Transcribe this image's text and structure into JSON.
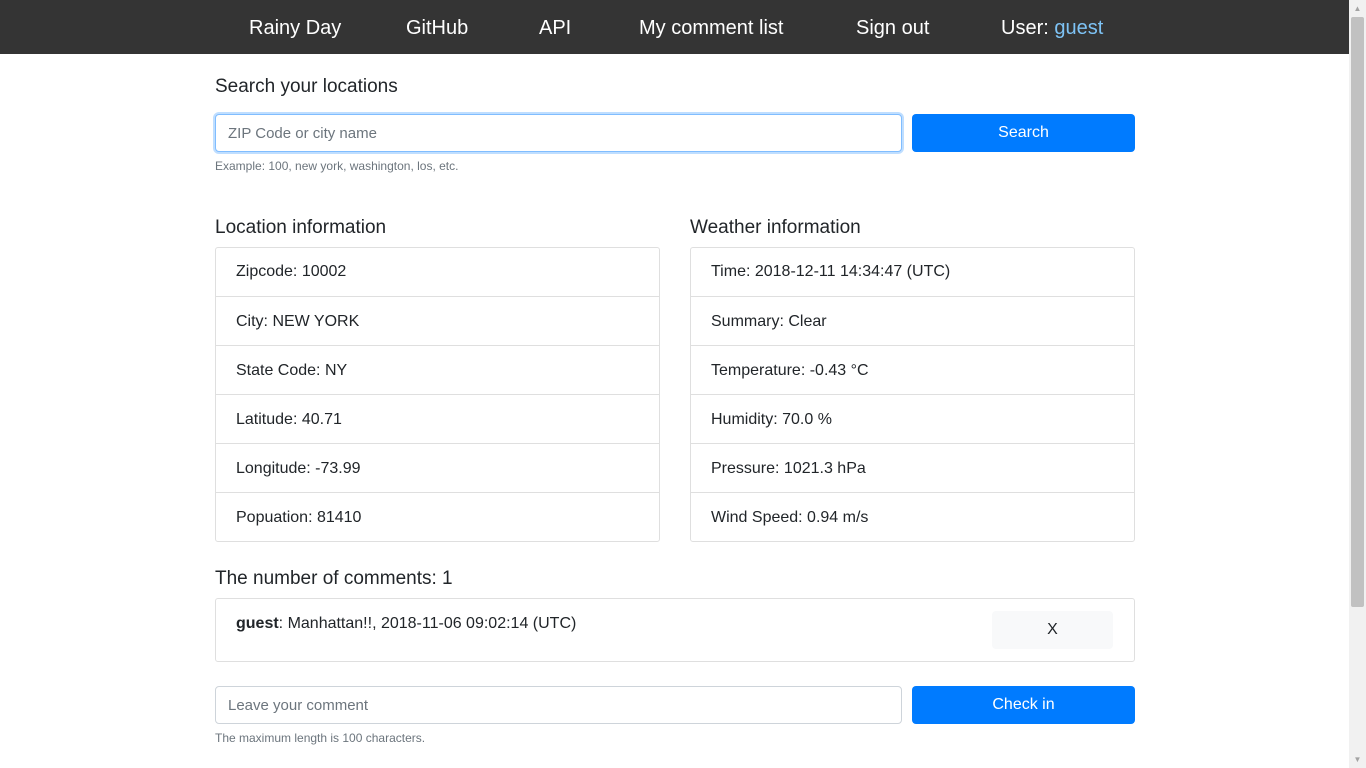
{
  "nav": {
    "brand": "Rainy Day",
    "github": "GitHub",
    "api": "API",
    "comment_list": "My comment list",
    "sign_out": "Sign out",
    "user_label": "User: ",
    "user_name": "guest"
  },
  "search": {
    "heading": "Search your locations",
    "placeholder": "ZIP Code or city name",
    "button": "Search",
    "help": "Example: 100, new york, washington, los, etc."
  },
  "location": {
    "heading": "Location information",
    "items": [
      "Zipcode: 10002",
      "City: NEW YORK",
      "State Code: NY",
      "Latitude: 40.71",
      "Longitude: -73.99",
      "Popuation: 81410"
    ]
  },
  "weather": {
    "heading": "Weather information",
    "items": [
      "Time: 2018-12-11 14:34:47 (UTC)",
      "Summary: Clear",
      "Temperature: -0.43 °C",
      "Humidity: 70.0 %",
      "Pressure: 1021.3 hPa",
      "Wind Speed: 0.94 m/s"
    ]
  },
  "comments": {
    "heading": "The number of comments: 1",
    "items": [
      {
        "user": "guest",
        "text": ": Manhattan!!, 2018-11-06 09:02:14 (UTC)",
        "delete_label": "X"
      }
    ]
  },
  "new_comment": {
    "placeholder": "Leave your comment",
    "button": "Check in",
    "help": "The maximum length is 100 characters."
  },
  "colors": {
    "navbar": "#343434",
    "primary": "#007bff",
    "user_link": "#7ec3f5"
  }
}
